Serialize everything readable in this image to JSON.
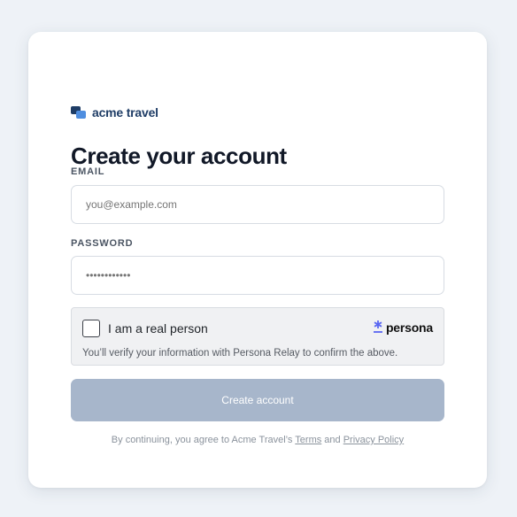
{
  "brand": {
    "name": "acme travel",
    "color": "#1f3d66"
  },
  "page": {
    "title": "Create your account"
  },
  "form": {
    "email_label": "EMAIL",
    "email_placeholder": "you@example.com",
    "password_label": "PASSWORD",
    "password_placeholder": "••••••••••••"
  },
  "verification": {
    "checkbox_label": "I am a real person",
    "checked": false,
    "provider": "persona",
    "provider_icon": "asterisk-icon",
    "accent": "#5a67f2",
    "note": "You’ll verify your information with Persona Relay to confirm the above."
  },
  "submit": {
    "label": "Create account",
    "color": "#a7b6cb"
  },
  "legal": {
    "prefix": "By continuing, you agree to Acme Travel’s ",
    "terms": "Terms",
    "joiner": " and ",
    "privacy": "Privacy Policy"
  }
}
